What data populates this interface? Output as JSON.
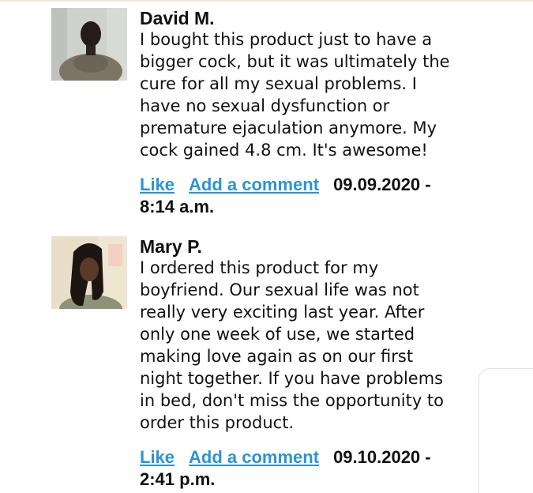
{
  "comments": [
    {
      "author": "David M.",
      "text": "I bought this product just to have a bigger cock, but it was ultimately the cure for all my sexual problems. I have no sexual dysfunction or premature ejaculation anymore. My cock gained 4.8 cm. It's awesome!",
      "like_label": "Like",
      "comment_label": "Add a comment",
      "date": "09.09.2020 - 8:14 a.m."
    },
    {
      "author": "Mary P.",
      "text": "I ordered this product for my boyfriend. Our sexual life was not really very exciting last year. After only one week of use, we started making love again as on our first night together. If you have problems in bed, don't miss the opportunity to order this product.",
      "like_label": "Like",
      "comment_label": "Add a comment",
      "date": "09.10.2020 - 2:41 p.m."
    }
  ],
  "colors": {
    "link": "#2b93d8",
    "text": "#111111"
  }
}
